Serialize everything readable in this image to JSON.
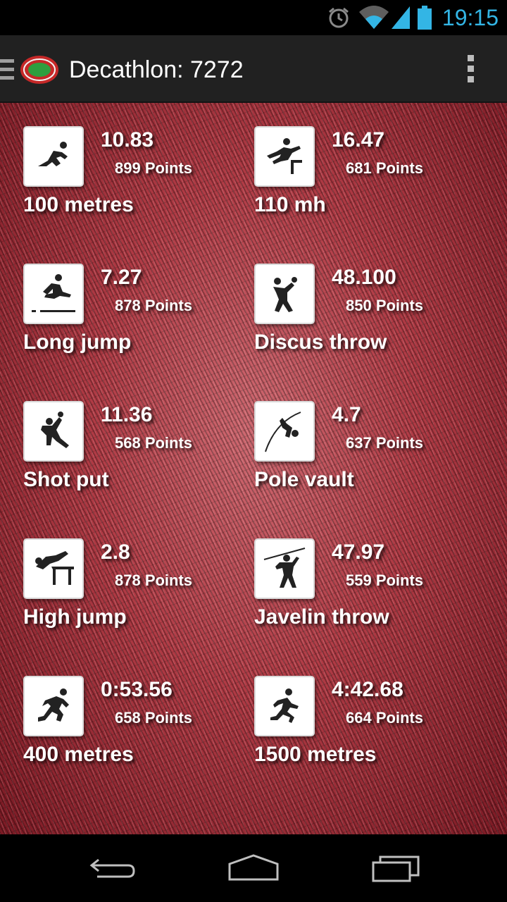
{
  "status_bar": {
    "time": "19:15",
    "icons": [
      "alarm-icon",
      "wifi-icon",
      "cell-signal-icon",
      "battery-icon"
    ],
    "accent_color": "#33b5e5"
  },
  "action_bar": {
    "title": "Decathlon: 7272",
    "icons": [
      "drawer-icon",
      "stadium-logo-icon",
      "overflow-menu-icon"
    ]
  },
  "events": [
    {
      "name": "100 metres",
      "result": "10.83",
      "points": "899 Points",
      "icon": "sprint-start-icon"
    },
    {
      "name": "110 mh",
      "result": "16.47",
      "points": "681 Points",
      "icon": "hurdles-icon"
    },
    {
      "name": "Long jump",
      "result": "7.27",
      "points": "878 Points",
      "icon": "long-jump-icon"
    },
    {
      "name": "Discus throw",
      "result": "48.100",
      "points": "850 Points",
      "icon": "discus-icon"
    },
    {
      "name": "Shot put",
      "result": "11.36",
      "points": "568 Points",
      "icon": "shot-put-icon"
    },
    {
      "name": "Pole vault",
      "result": "4.7",
      "points": "637 Points",
      "icon": "pole-vault-icon"
    },
    {
      "name": "High jump",
      "result": "2.8",
      "points": "878 Points",
      "icon": "high-jump-icon"
    },
    {
      "name": "Javelin throw",
      "result": "47.97",
      "points": "559 Points",
      "icon": "javelin-icon"
    },
    {
      "name": "400 metres",
      "result": "0:53.56",
      "points": "658 Points",
      "icon": "runner-icon"
    },
    {
      "name": "1500 metres",
      "result": "4:42.68",
      "points": "664 Points",
      "icon": "distance-runner-icon"
    }
  ],
  "nav_bar": {
    "icons": [
      "back-icon",
      "home-icon",
      "recent-apps-icon"
    ]
  }
}
